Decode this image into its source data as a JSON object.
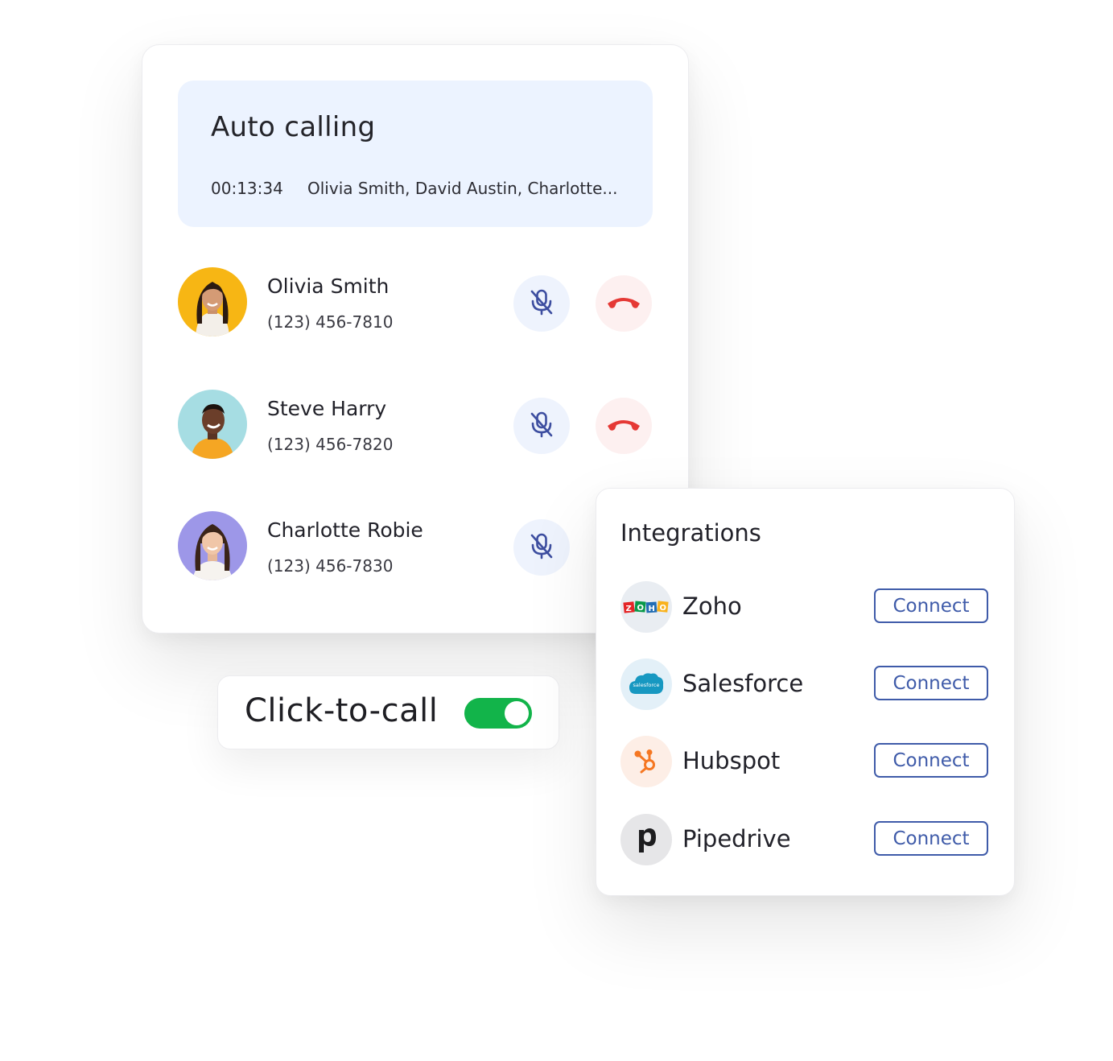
{
  "call_panel": {
    "title": "Auto calling",
    "timer": "00:13:34",
    "participants": "Olivia Smith, David Austin, Charlotte...",
    "contacts": [
      {
        "name": "Olivia Smith",
        "phone": "(123) 456-7810",
        "avatar_bg": "#f7b614",
        "show_hangup": true
      },
      {
        "name": "Steve Harry",
        "phone": "(123) 456-7820",
        "avatar_bg": "#a6dde3",
        "show_hangup": true
      },
      {
        "name": "Charlotte Robie",
        "phone": "(123) 456-7830",
        "avatar_bg": "#9d97e8",
        "show_hangup": false
      }
    ]
  },
  "click_to_call": {
    "label": "Click-to-call",
    "enabled": true
  },
  "integrations": {
    "title": "Integrations",
    "items": [
      {
        "name": "Zoho",
        "button": "Connect",
        "icon": "zoho-logo-icon"
      },
      {
        "name": "Salesforce",
        "button": "Connect",
        "icon": "salesforce-logo-icon",
        "logo_text": "salesforce"
      },
      {
        "name": "Hubspot",
        "button": "Connect",
        "icon": "hubspot-logo-icon"
      },
      {
        "name": "Pipedrive",
        "button": "Connect",
        "icon": "pipedrive-logo-icon"
      }
    ]
  },
  "colors": {
    "accent_blue": "#3f5ba9",
    "header_bg": "#ecf3ff",
    "hangup_red": "#e53935",
    "toggle_green": "#12b44a"
  }
}
